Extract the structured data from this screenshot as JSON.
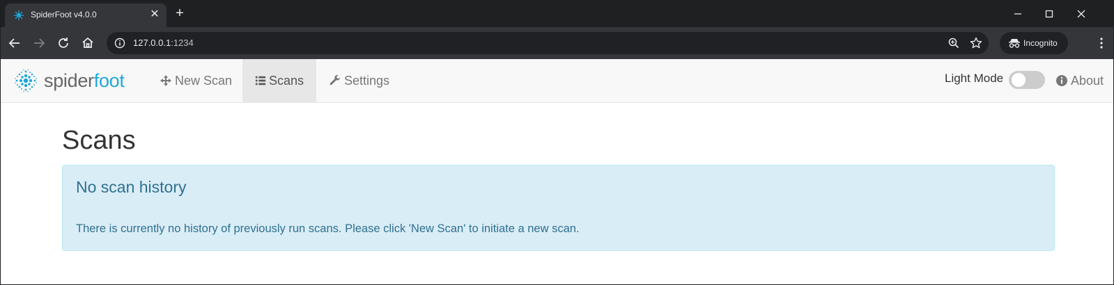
{
  "browser": {
    "tab_title": "SpiderFoot v4.0.0",
    "tab_close": "✕",
    "new_tab": "+",
    "url_host": "127.0.0.1",
    "url_port": ":1234",
    "incognito_label": "Incognito"
  },
  "app": {
    "brand_part1": "spider",
    "brand_part2": "foot",
    "brand_color": "#1fa8d8",
    "nav": {
      "new_scan": "New Scan",
      "scans": "Scans",
      "settings": "Settings",
      "light_mode": "Light Mode",
      "light_mode_on": false,
      "about": "About"
    }
  },
  "main": {
    "title": "Scans",
    "alert": {
      "heading": "No scan history",
      "text": "There is currently no history of previously run scans. Please click 'New Scan' to initiate a new scan.",
      "background": "#d9edf7",
      "text_color": "#31708f"
    }
  },
  "icons": [
    "spiderfoot-favicon",
    "close-icon",
    "plus-icon",
    "minimize-icon",
    "maximize-icon",
    "window-close-icon",
    "back-icon",
    "forward-icon",
    "reload-icon",
    "home-icon",
    "info-icon",
    "zoom-icon",
    "star-icon",
    "incognito-icon",
    "kebab-menu-icon",
    "spiderfoot-logo",
    "move-icon",
    "list-icon",
    "wrench-icon",
    "info-circle-icon"
  ]
}
